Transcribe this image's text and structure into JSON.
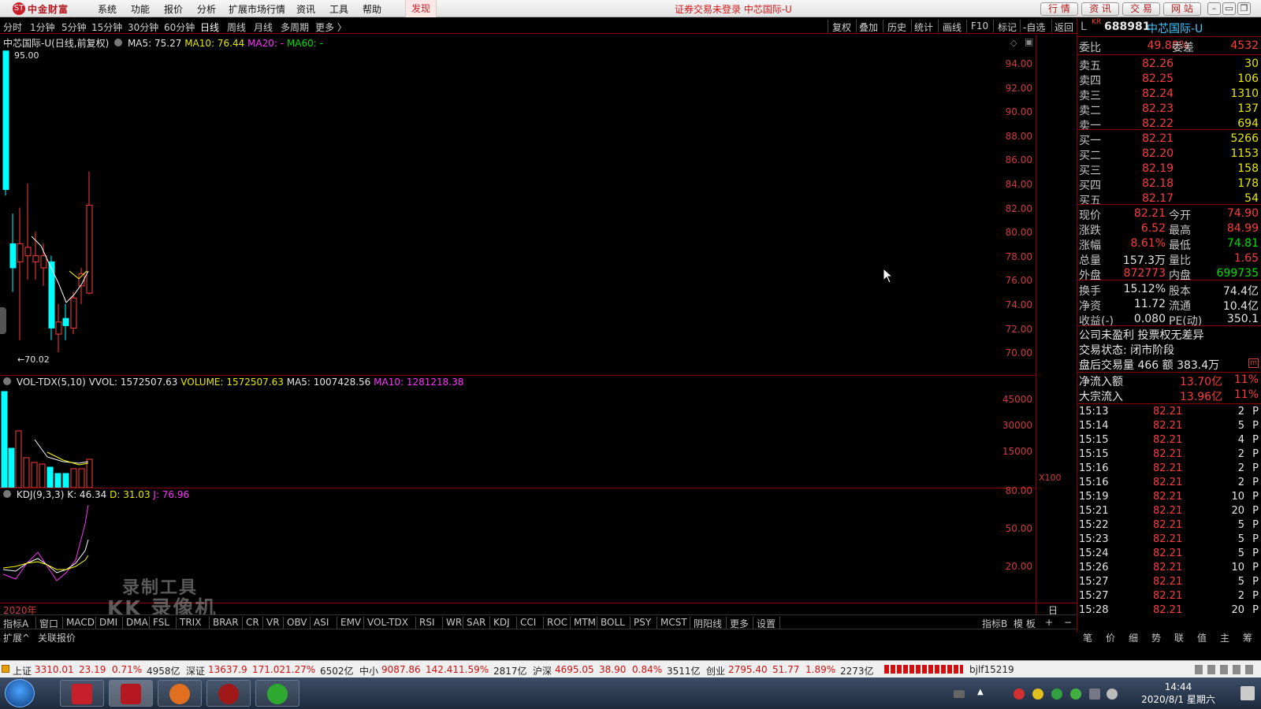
{
  "titlebar": {
    "logo_text": "中金财富",
    "logo_mark": "ST",
    "menus": [
      "系统",
      "功能",
      "报价",
      "分析",
      "扩展市场行情",
      "资讯",
      "工具",
      "帮助"
    ],
    "discover": "发现",
    "login_status": "证券交易未登录  中芯国际-U",
    "top_buttons": [
      "行 情",
      "资 讯",
      "交 易",
      "网 站"
    ],
    "win_buttons": [
      "–",
      "▭",
      "❐",
      "✕"
    ]
  },
  "periods": [
    "分时",
    "1分钟",
    "5分钟",
    "15分钟",
    "30分钟",
    "60分钟",
    "日线",
    "周线",
    "月线",
    "多周期",
    "更多 〉"
  ],
  "right_tools": [
    "复权",
    "叠加",
    "历史",
    "统计",
    "画线",
    "F10",
    "标记",
    "-自选",
    "返回"
  ],
  "main_panel": {
    "title": "中芯国际-U(日线,前复权)",
    "ma5": "MA5: 75.27",
    "ma10": "MA10: 76.44",
    "ma20": "MA20: -",
    "ma60": "MA60: -",
    "high_label": "95.00",
    "low_label": "←70.02",
    "yticks": [
      "94.00",
      "92.00",
      "90.00",
      "88.00",
      "86.00",
      "84.00",
      "82.00",
      "80.00",
      "78.00",
      "76.00",
      "74.00",
      "72.00",
      "70.00"
    ]
  },
  "vol_panel": {
    "title": "VOL-TDX(5,10)",
    "vvol": "VVOL: 1572507.63",
    "volume": "VOLUME: 1572507.63",
    "ma5": "MA5: 1007428.56",
    "ma10": "MA10: 1281218.38",
    "yticks": [
      "45000",
      "30000",
      "15000"
    ],
    "unit": "X100"
  },
  "kdj_panel": {
    "title": "KDJ(9,3,3)",
    "k": "K: 46.34",
    "d": "D: 31.03",
    "j": "J: 76.96",
    "yticks": [
      "80.00",
      "50.00",
      "20.00"
    ],
    "year": "2020年",
    "period_label": "日线"
  },
  "watermark": {
    "line1": "录制工具",
    "line2": "KK 录像机"
  },
  "indicators": [
    "指标A",
    "窗口",
    "MACD",
    "DMI",
    "DMA",
    "FSL",
    "TRIX",
    "BRAR",
    "CR",
    "VR",
    "OBV",
    "ASI",
    "EMV",
    "VOL-TDX",
    "RSI",
    "WR",
    "SAR",
    "KDJ",
    "CCI",
    "ROC",
    "MTM",
    "BOLL",
    "PSY",
    "MCST",
    "阴阳线",
    "更多",
    "设置"
  ],
  "indicators_right": [
    "指标B",
    "模 板",
    "+",
    "−"
  ],
  "ext_tabs": [
    "扩展^",
    "关联报价"
  ],
  "right_tabs": [
    "笔",
    "价",
    "细",
    "势",
    "联",
    "值",
    "主",
    "筹"
  ],
  "quote": {
    "prefix": "KR",
    "code": "688981",
    "name": "中芯国际-U",
    "webi_label": "委比",
    "webi": "49.88%",
    "weicha_label": "委差",
    "weicha": "4532",
    "asks": [
      {
        "label": "卖五",
        "price": "82.26",
        "vol": "30"
      },
      {
        "label": "卖四",
        "price": "82.25",
        "vol": "106"
      },
      {
        "label": "卖三",
        "price": "82.24",
        "vol": "1310"
      },
      {
        "label": "卖二",
        "price": "82.23",
        "vol": "137"
      },
      {
        "label": "卖一",
        "price": "82.22",
        "vol": "694"
      }
    ],
    "bids": [
      {
        "label": "买一",
        "price": "82.21",
        "vol": "5266"
      },
      {
        "label": "买二",
        "price": "82.20",
        "vol": "1153"
      },
      {
        "label": "买三",
        "price": "82.19",
        "vol": "158"
      },
      {
        "label": "买四",
        "price": "82.18",
        "vol": "178"
      },
      {
        "label": "买五",
        "price": "82.17",
        "vol": "54"
      }
    ],
    "stats": [
      {
        "l1": "现价",
        "v1": "82.21",
        "l2": "今开",
        "v2": "74.90"
      },
      {
        "l1": "涨跌",
        "v1": "6.52",
        "l2": "最高",
        "v2": "84.99"
      },
      {
        "l1": "涨幅",
        "v1": "8.61%",
        "l2": "最低",
        "v2": "74.81"
      },
      {
        "l1": "总量",
        "v1": "157.3万",
        "l2": "量比",
        "v2": "1.65"
      },
      {
        "l1": "外盘",
        "v1": "872773",
        "l2": "内盘",
        "v2": "699735"
      }
    ],
    "stats2": [
      {
        "l1": "换手",
        "v1": "15.12%",
        "l2": "股本",
        "v2": "74.4亿"
      },
      {
        "l1": "净资",
        "v1": "11.72",
        "l2": "流通",
        "v2": "10.4亿"
      },
      {
        "l1": "收益(-)",
        "v1": "0.080",
        "l2": "PE(动)",
        "v2": "350.1"
      }
    ],
    "note1": "公司未盈利 投票权无差异",
    "note2": "交易状态: 闭市阶段",
    "note3": "盘后交易量 466 额 383.4万",
    "flow1_label": "净流入额",
    "flow1_val": "13.70亿",
    "flow1_pct": "11%",
    "flow2_label": "大宗流入",
    "flow2_val": "13.96亿",
    "flow2_pct": "11%",
    "ticks": [
      {
        "t": "15:13",
        "p": "82.21",
        "v": "2",
        "f": "P"
      },
      {
        "t": "15:14",
        "p": "82.21",
        "v": "5",
        "f": "P"
      },
      {
        "t": "15:15",
        "p": "82.21",
        "v": "4",
        "f": "P"
      },
      {
        "t": "15:15",
        "p": "82.21",
        "v": "2",
        "f": "P"
      },
      {
        "t": "15:16",
        "p": "82.21",
        "v": "2",
        "f": "P"
      },
      {
        "t": "15:16",
        "p": "82.21",
        "v": "2",
        "f": "P"
      },
      {
        "t": "15:19",
        "p": "82.21",
        "v": "10",
        "f": "P"
      },
      {
        "t": "15:21",
        "p": "82.21",
        "v": "20",
        "f": "P"
      },
      {
        "t": "15:22",
        "p": "82.21",
        "v": "5",
        "f": "P"
      },
      {
        "t": "15:23",
        "p": "82.21",
        "v": "5",
        "f": "P"
      },
      {
        "t": "15:24",
        "p": "82.21",
        "v": "5",
        "f": "P"
      },
      {
        "t": "15:26",
        "p": "82.21",
        "v": "10",
        "f": "P"
      },
      {
        "t": "15:27",
        "p": "82.21",
        "v": "5",
        "f": "P"
      },
      {
        "t": "15:27",
        "p": "82.21",
        "v": "2",
        "f": "P"
      },
      {
        "t": "15:28",
        "p": "82.21",
        "v": "20",
        "f": "P"
      }
    ]
  },
  "ticker": [
    {
      "name": "上证",
      "price": "3310.01",
      "chg": "23.19",
      "pct": "0.71%",
      "amt": "4958亿"
    },
    {
      "name": "深证",
      "price": "13637.9",
      "chg": "171.02",
      "pct": "1.27%",
      "amt": "6502亿"
    },
    {
      "name": "中小",
      "price": "9087.86",
      "chg": "142.41",
      "pct": "1.59%",
      "amt": "2817亿"
    },
    {
      "name": "沪深",
      "price": "4695.05",
      "chg": "38.90",
      "pct": "0.84%",
      "amt": "3511亿"
    },
    {
      "name": "创业",
      "price": "2795.40",
      "chg": "51.77",
      "pct": "1.89%",
      "amt": "2273亿"
    }
  ],
  "ticker_server": "bjlf15219",
  "clock": {
    "time": "14:44",
    "date": "2020/8/1 星期六"
  },
  "colors": {
    "up": "#ff3c3c",
    "down": "#00ffff",
    "grid": "#8a0000",
    "ma5": "#ffffff",
    "ma10": "#ffff00",
    "ma20": "#ff00ff",
    "ma60": "#00ff00"
  }
}
